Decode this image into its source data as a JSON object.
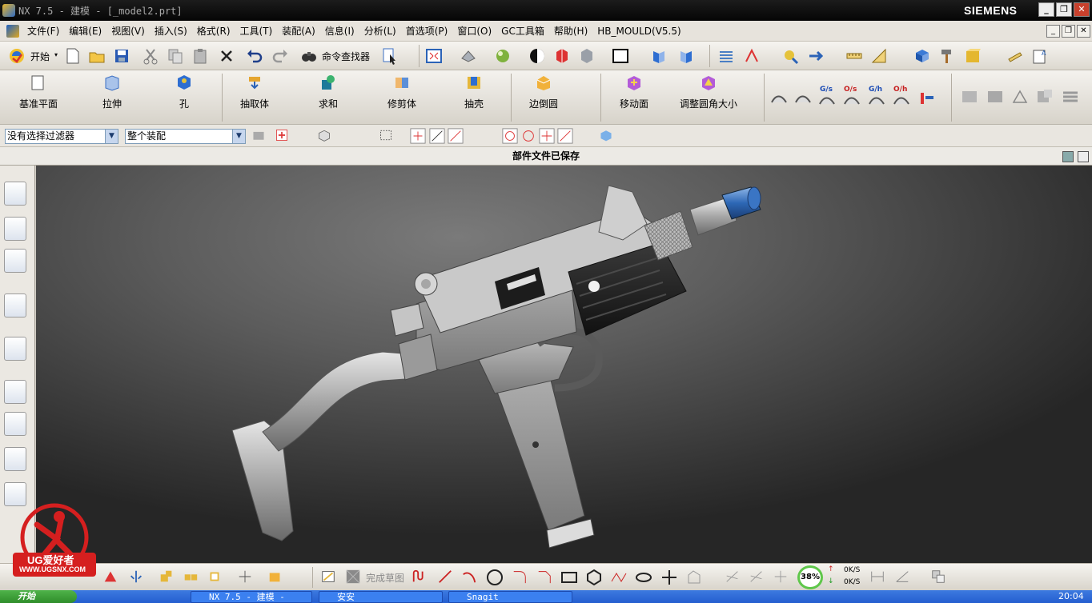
{
  "window": {
    "title": "NX 7.5 - 建模 - [_model2.prt]",
    "brand": "SIEMENS",
    "controls": [
      "_",
      "❐",
      "✕"
    ]
  },
  "menu": {
    "items": [
      "文件(F)",
      "编辑(E)",
      "视图(V)",
      "插入(S)",
      "格式(R)",
      "工具(T)",
      "装配(A)",
      "信息(I)",
      "分析(L)",
      "首选项(P)",
      "窗口(O)",
      "GC工具箱",
      "帮助(H)",
      "HB_MOULD(V5.5)"
    ]
  },
  "toolbar_standard": {
    "start": "开始",
    "command_finder": "命令查找器"
  },
  "toolbar_feature": {
    "buttons": [
      "基准平面",
      "拉伸",
      "孔",
      "抽取体",
      "求和",
      "修剪体",
      "抽壳",
      "边倒圆",
      "移动面",
      "调整圆角大小"
    ],
    "surface_labels": [
      "G/s",
      "O/s",
      "G/h",
      "O/h"
    ]
  },
  "selection": {
    "filter": "没有选择过滤器",
    "scope": "整个装配"
  },
  "status": {
    "cue": "部件文件已保存"
  },
  "sketch_toolbar": {
    "finish_sketch": "完成草图"
  },
  "network": {
    "percent": "38%",
    "up": "0K/S",
    "down": "0K/S"
  },
  "watermark": {
    "text": "UG爱好者",
    "url": "WWW.UGSNX.COM"
  },
  "taskbar": {
    "start": "开始",
    "tasks": [
      "NX 7.5 - 建模 -",
      "安安",
      "Snagit"
    ],
    "clock": "20:04"
  },
  "colors": {
    "titlebar": "#0e0e0e",
    "viewport_top": "#7a7a7a",
    "viewport_bottom": "#262626",
    "taskbar": "#2f6ad8",
    "accent_blue": "#2b63b7"
  }
}
